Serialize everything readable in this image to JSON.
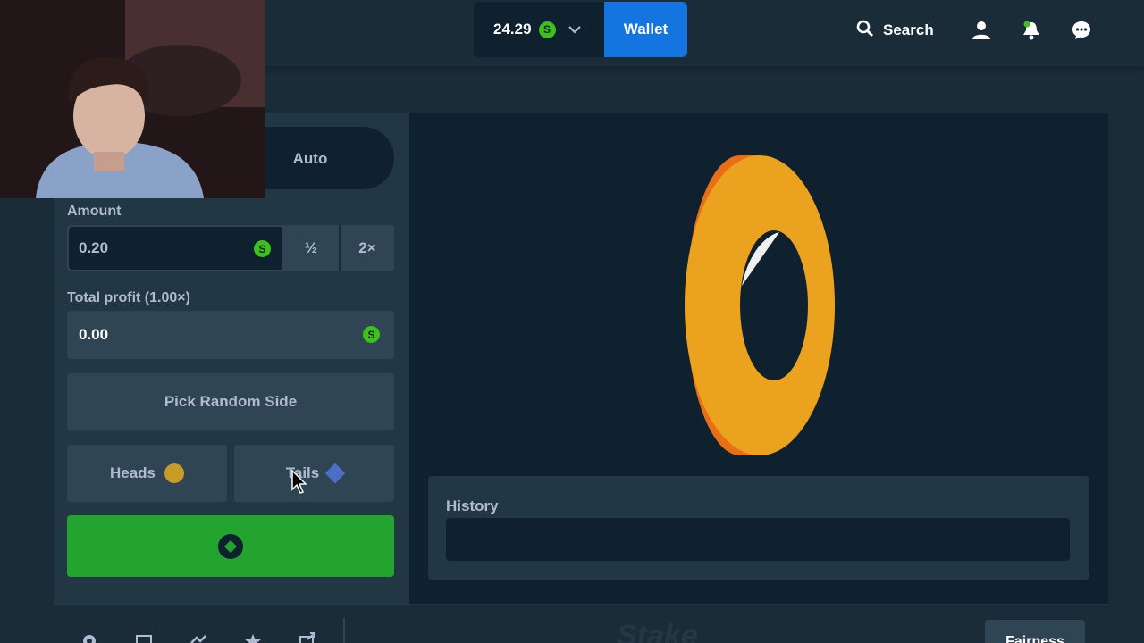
{
  "header": {
    "balance": "24.29",
    "currency_symbol": "S",
    "wallet_label": "Wallet",
    "search_label": "Search"
  },
  "bet_panel": {
    "auto_tab_label": "Auto",
    "amount_label": "Amount",
    "amount_value": "0.20",
    "half_label": "½",
    "double_label": "2×",
    "profit_label": "Total profit (1.00×)",
    "profit_value": "0.00",
    "random_side_label": "Pick Random Side",
    "heads_label": "Heads",
    "tails_label": "Tails"
  },
  "game": {
    "history_label": "History"
  },
  "footer": {
    "watermark": "Stake",
    "fairness_label": "Fairness"
  },
  "colors": {
    "accent_green": "#23a42f",
    "wallet_blue": "#1475e1",
    "coin_orange": "#e86f16",
    "coin_gold": "#eba31f"
  }
}
